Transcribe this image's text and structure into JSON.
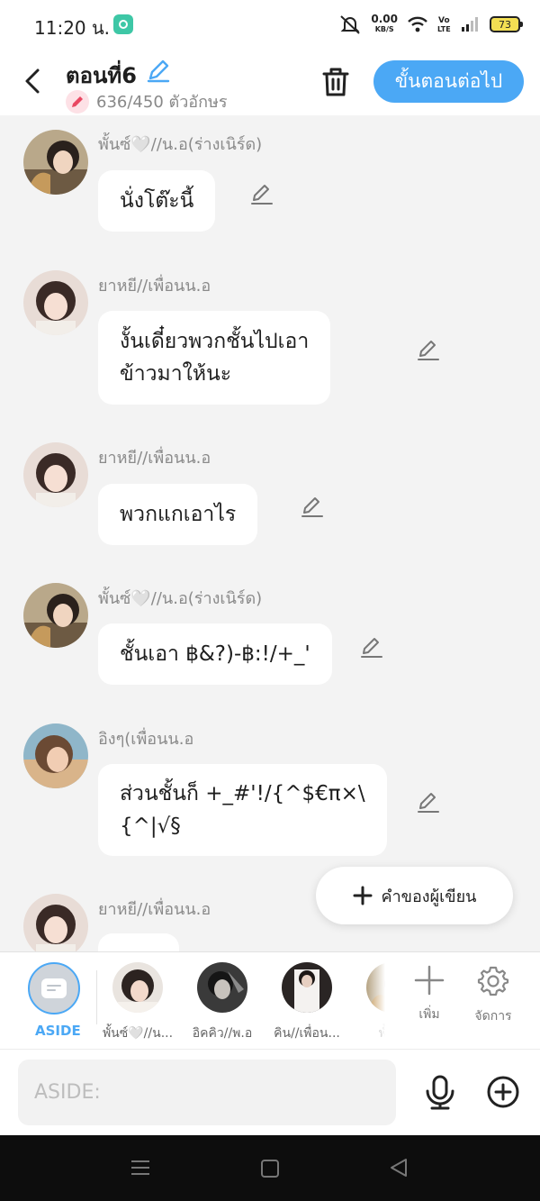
{
  "status_bar": {
    "time": "11:20 น.",
    "net_speed": "0.00",
    "net_unit": "KB/S",
    "battery": "73"
  },
  "header": {
    "title": "ตอนที่6",
    "char_count": "636/450 ตัวอักษร",
    "next_label": "ขั้นตอนต่อไป"
  },
  "messages": [
    {
      "sender": "พั้นซ์🤍//น.อ(ร่างเนิร์ด)",
      "text": "นั่งโต๊ะนี้"
    },
    {
      "sender": "ยาหยี//เพื่อนน.อ",
      "line1": "งั้นเดี๋ยวพวกชั้นไปเอา",
      "line2": "ข้าวมาให้นะ"
    },
    {
      "sender": "ยาหยี//เพื่อนน.อ",
      "text": "พวกแกเอาไร"
    },
    {
      "sender": "พั้นซ์🤍//น.อ(ร่างเนิร์ด)",
      "text": "ชั้นเอา ฿&?)-฿:!/+_'"
    },
    {
      "sender": "อิงๆ(เพื่อนน.อ",
      "line1": "ส่วนชั้นก็ +_#'!/{^$€π×\\",
      "line2": "{^|√§"
    },
    {
      "sender": "ยาหยี//เพื่อนน.อ",
      "text": ""
    }
  ],
  "author_note_label": "คำของผู้เขียน",
  "character_bar": {
    "aside_label": "ASIDE",
    "characters": [
      {
        "label": "พั้นซ์🤍//น..."
      },
      {
        "label": "อิคคิว//พ.อ"
      },
      {
        "label": "คิน//เพื่อน..."
      },
      {
        "label": "พั้นซ์"
      }
    ],
    "add_label": "เพิ่ม",
    "manage_label": "จัดการ"
  },
  "input": {
    "placeholder": "ASIDE:"
  },
  "colors": {
    "accent": "#4ba8f5",
    "background": "#f3f3f3",
    "bubble": "#ffffff"
  }
}
